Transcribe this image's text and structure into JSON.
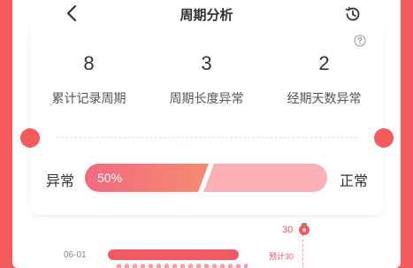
{
  "header": {
    "title": "周期分析"
  },
  "card": {
    "stats": [
      {
        "value": "8",
        "label": "累计记录周期"
      },
      {
        "value": "3",
        "label": "周期长度异常"
      },
      {
        "value": "2",
        "label": "经期天数异常"
      }
    ],
    "ratio": {
      "left_label": "异常",
      "right_label": "正常",
      "abnormal_text": "50%",
      "abnormal_fraction": 0.5
    }
  },
  "timeline": {
    "date_label": "06-01",
    "day_marker": "30",
    "expected_label": "预计30"
  },
  "colors": {
    "background": "#f55a5f",
    "abnormal_gradient_start": "#f26b80",
    "abnormal_gradient_end": "#f58a72",
    "normal": "#fbb1b7"
  }
}
